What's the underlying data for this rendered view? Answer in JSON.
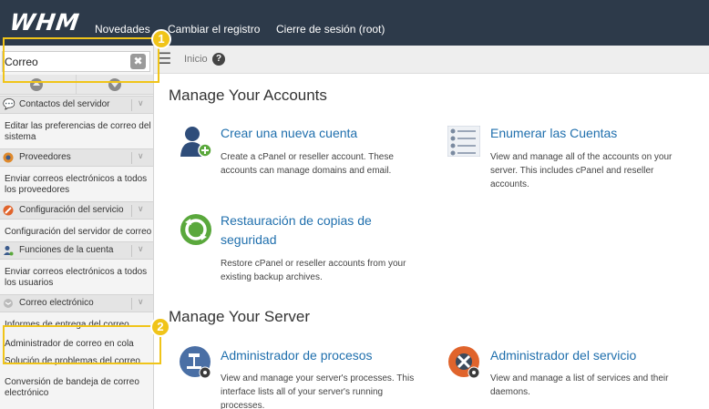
{
  "topbar": {
    "logo": "WHM",
    "nav": [
      "Novedades",
      "Cambiar el registro",
      "Cierre de sesión (root)"
    ]
  },
  "sidebar": {
    "search_value": "Correo",
    "search_clear": "✖",
    "categories": [
      {
        "label": "Contactos del servidor",
        "icon": "chat-icon",
        "link": "Editar las preferencias de correo del sistema"
      },
      {
        "label": "Proveedores",
        "icon": "provider-icon",
        "link": "Enviar correos electrónicos a todos los proveedores"
      },
      {
        "label": "Configuración del servicio",
        "icon": "service-config-icon",
        "link": "Configuración del servidor de correo"
      },
      {
        "label": "Funciones de la cuenta",
        "icon": "account-user-icon",
        "link": "Enviar correos electrónicos a todos los usuarios"
      },
      {
        "label": "Correo electrónico",
        "icon": "email-icon"
      }
    ],
    "email_links": [
      "Informes de entrega del correo",
      "Administrador de correo en cola",
      "Solución de problemas del correo",
      "Conversión de bandeja de correo electrónico"
    ]
  },
  "annotations": {
    "badge_1": "1",
    "badge_2": "2",
    "color": "#f0c419"
  },
  "breadcrumb": {
    "home": "Inicio"
  },
  "main": {
    "sections": [
      {
        "title": "Manage Your Accounts",
        "items": [
          {
            "title": "Crear una nueva cuenta",
            "desc": "Create a cPanel or reseller account. These accounts can manage domains and email.",
            "icon": "create-account-icon"
          },
          {
            "title": "Enumerar las Cuentas",
            "desc": "View and manage all of the accounts on your server. This includes cPanel and reseller accounts.",
            "icon": "list-accounts-icon"
          },
          {
            "title": "Restauración de copias de seguridad",
            "desc": "Restore cPanel or reseller accounts from your existing backup archives.",
            "icon": "restore-backup-icon"
          }
        ]
      },
      {
        "title": "Manage Your Server",
        "items": [
          {
            "title": "Administrador de procesos",
            "desc": "View and manage your server's processes. This interface lists all of your server's running processes.",
            "icon": "process-manager-icon"
          },
          {
            "title": "Administrador del servicio",
            "desc": "View and manage a list of services and their daemons.",
            "icon": "service-manager-icon"
          }
        ]
      }
    ]
  },
  "colors": {
    "topbar": "#2d3a4a",
    "link": "#1f6fad",
    "highlight": "#f0c419"
  }
}
